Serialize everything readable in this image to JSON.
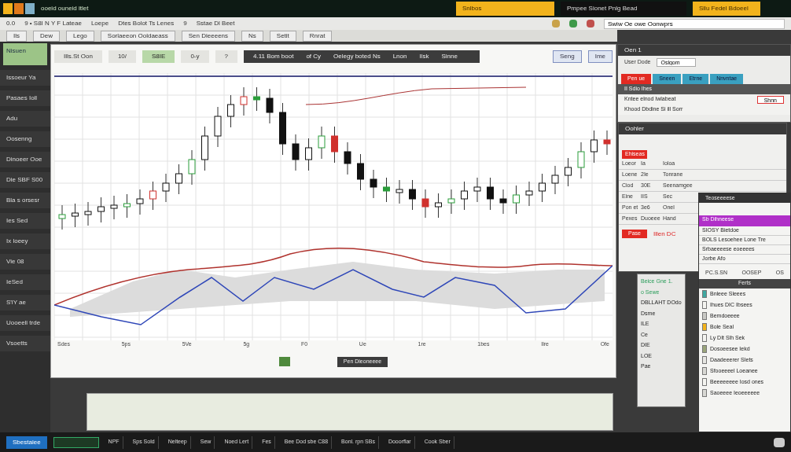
{
  "title_bar": {
    "title": "ooeid ouneid itlet",
    "tabs": [
      {
        "label": "Snlbos",
        "selected": true
      },
      {
        "label": "Pmpee Sionet Pnlg Bead",
        "selected": false
      },
      {
        "label": "Sllu Fedel Bdoeel",
        "selected": true
      }
    ]
  },
  "menu_bar": {
    "items": [
      "0.0",
      "9 • S8I N Y F Lateae",
      "Loepe",
      "Dtes Bolot Ts Lenes",
      "9",
      "Sstae Dl Beet"
    ],
    "search": {
      "value": "Swiw Oe owe Oonwprs"
    }
  },
  "toolbar": {
    "items": [
      "Ils",
      "Dew",
      "Lego",
      "Sorlaeeon Ooldaeass",
      "Sen Dieeeens",
      "Ns",
      "Setit",
      "Rnrat"
    ]
  },
  "sidebar": {
    "header": "Nisuen",
    "items": [
      "Issoeur Ya",
      "Pasaes Ioll",
      "Adu",
      "Oosenng",
      "Dinoeer Ooe",
      "Die SBF S00",
      "Bla s orsesr",
      "Ies Sed",
      "Ix loeey",
      "Vie 08",
      "IeSed",
      "S'lY ae",
      "Uooeeli trde",
      "Vsoetts"
    ]
  },
  "chart_panel": {
    "tabs": [
      {
        "label": "Ills.St Oon",
        "selected": false
      },
      {
        "label": "10/",
        "selected": false
      },
      {
        "label": "S8IE",
        "selected": true
      },
      {
        "label": "0-y",
        "selected": false
      },
      {
        "label": "?",
        "selected": false
      }
    ],
    "dark_items": [
      "4.11 Bom boot",
      "of Cy",
      "Oelegy boted Ns",
      "Lnon",
      "Ilsk",
      "Sinne"
    ],
    "side_buttons": [
      "Seng",
      "Ime"
    ],
    "x_labels": [
      "Sdes",
      "5ps",
      "5Ve",
      "5g",
      "F0",
      "Ue",
      "1re",
      "1bes",
      "Ilre",
      "Ofe"
    ],
    "footer_button": "Pen Dieoneeee"
  },
  "order_window": {
    "title": "Oen 1",
    "field_label": "User Dode",
    "field_value": "Oslgom",
    "tabs": [
      {
        "label": "Pen ue",
        "selected": true
      },
      {
        "label": "Sneen",
        "selected": false
      },
      {
        "label": "Etrne",
        "selected": false
      },
      {
        "label": "Nnvntae",
        "selected": false
      }
    ],
    "rows": [
      "II Sdio Ihes",
      "Kntee elnod Iwlabeat",
      "Khood Dbdine Si ill Sorr"
    ],
    "button": "Shnn"
  },
  "table_window": {
    "title": "Oohler",
    "badge": "Ehiseas",
    "rows": [
      [
        "Loeor",
        "Ia",
        "Ioloa"
      ],
      [
        "Loene",
        "2Ie",
        "Tonrane"
      ],
      [
        "Ciod",
        "30E",
        "Seenamgee"
      ],
      [
        "Eine",
        "IIS",
        "Sec"
      ],
      [
        "Pon et",
        "3e6",
        "Onel"
      ],
      [
        "Pexes",
        "Duoeee",
        "Hand"
      ]
    ],
    "alert_button": "Pase",
    "alert_text": "Illen DC"
  },
  "notes_panel": {
    "lines": [
      "Beice Gne 1.",
      "o Sewe",
      "DBLLAHT DOdo",
      "Dsme",
      "ILE",
      "Ce",
      "DIE",
      "LOE",
      "Pae"
    ]
  },
  "list_window": {
    "title": "Teoseeeese",
    "header": "Sb Dihneese",
    "rows": [
      "SIOSY Bietdoe",
      "BOLS Lesoehee Lone Tre",
      "Srbaeeeese eoeeees",
      "Jorbe Afo"
    ],
    "footer": [
      "PC.S.SN",
      "OOSEP",
      "OS"
    ],
    "section": "Ferts",
    "items": [
      {
        "label": "Bnleee Sleees",
        "color": "#3fa7a0"
      },
      {
        "label": "Ihues DIC Ibsees",
        "color": "#f4f4f0"
      },
      {
        "label": "Bemdoeeee",
        "color": "#c8c8c4"
      },
      {
        "label": "Bole Seal",
        "color": "#f2b31c"
      },
      {
        "label": "Ly DIt Slh Sek",
        "color": "#f4f4f0"
      },
      {
        "label": "Dosoeesee Iekd",
        "color": "#9aa57a"
      },
      {
        "label": "Daadeeerer SIets",
        "color": "#e6e6e2"
      },
      {
        "label": "Sfooeeeel Loeanee",
        "color": "#d8d8d4"
      },
      {
        "label": "Beeeeeeee Iosd ones",
        "color": "#f4f4f0"
      },
      {
        "label": "Saoeeee Ieoeeeeee",
        "color": "#d8d8d4"
      }
    ]
  },
  "taskbar": {
    "start": "Sbestaiee",
    "items": [
      "NPF",
      "Sps Sold",
      "Nelteep",
      "Sew",
      "Noed Lert",
      "Fes",
      "Bee Dod sbe C88",
      "Bonl. rpn SBs",
      "Dooorflar",
      "Cook Sber"
    ]
  }
}
